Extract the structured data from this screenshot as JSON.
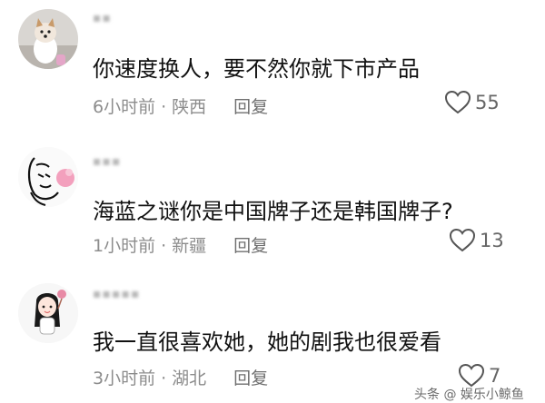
{
  "comments": [
    {
      "username": "▪▪",
      "text": "你速度换人，要不然你就下市产品",
      "time": "6小时前",
      "location": "陕西",
      "reply_label": "回复",
      "likes": "55",
      "avatar_icon": "dog-avatar"
    },
    {
      "username": "▪▪▪",
      "text": "海蓝之谜你是中国牌子还是韩国牌子?",
      "time": "1小时前",
      "location": "新疆",
      "reply_label": "回复",
      "likes": "13",
      "avatar_icon": "sketch-face-avatar"
    },
    {
      "username": "▪▪▪▪▪",
      "text": "我一直很喜欢她，她的剧我也很爱看",
      "time": "3小时前",
      "location": "湖北",
      "reply_label": "回复",
      "likes": "7",
      "avatar_icon": "cartoon-girl-avatar"
    }
  ],
  "separator": "·",
  "watermark": "头条 @ 娱乐小鲸鱼",
  "colors": {
    "text": "#111111",
    "meta": "#8c8c8c",
    "heart_outline": "#555555"
  }
}
